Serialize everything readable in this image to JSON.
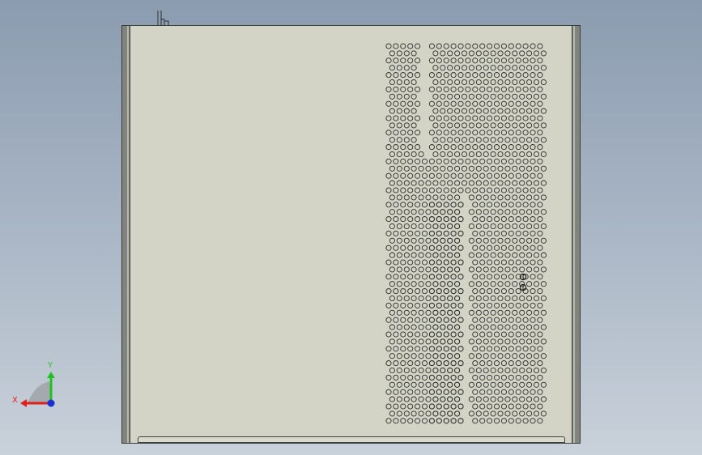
{
  "view": {
    "background_colors": [
      "#8b9cb0",
      "#c9d1da"
    ],
    "part_face_color": "#d3d4c6",
    "edge_color": "#3f4340",
    "rail_color": "#80847d"
  },
  "triad": {
    "x_label": "X",
    "y_label": "Y",
    "x_color": "#e0201a",
    "y_color": "#20c020",
    "z_color": "#1830d0",
    "icon": "axis-triad-icon"
  }
}
